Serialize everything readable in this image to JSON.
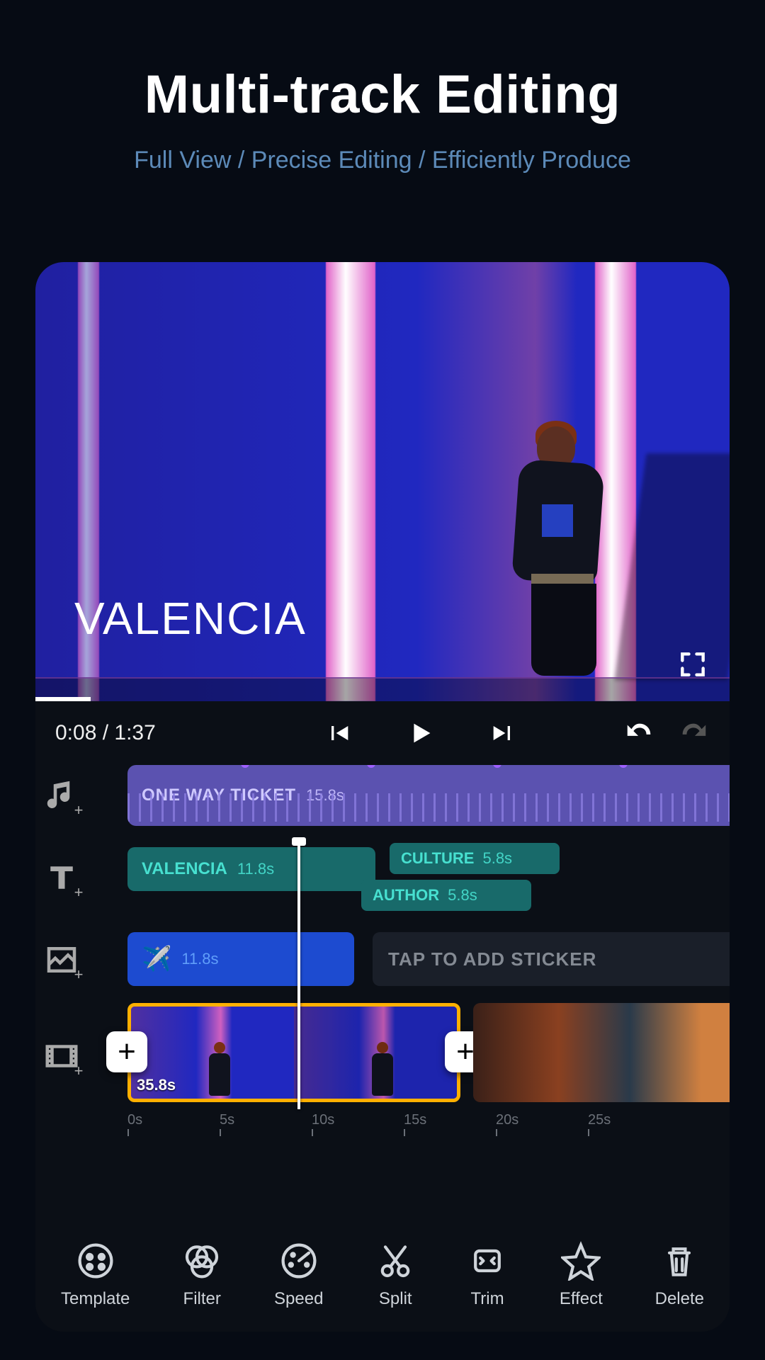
{
  "hero": {
    "title": "Multi-track Editing",
    "subtitle": "Full View / Precise Editing / Efficiently Produce"
  },
  "preview": {
    "overlay_text": "VALENCIA"
  },
  "transport": {
    "current_time": "0:08",
    "separator": " / ",
    "total_time": "1:37"
  },
  "tracks": {
    "music": {
      "title": "ONE WAY TICKET",
      "duration": "15.8s"
    },
    "text": {
      "main": {
        "title": "VALENCIA",
        "duration": "11.8s"
      },
      "chips": [
        {
          "title": "CULTURE",
          "duration": "5.8s"
        },
        {
          "title": "AUTHOR",
          "duration": "5.8s"
        }
      ]
    },
    "sticker": {
      "emoji": "✈️",
      "duration": "11.8s",
      "hint": "TAP TO ADD STICKER"
    },
    "video": {
      "duration": "35.8s"
    }
  },
  "ruler": {
    "labels": [
      "0s",
      "5s",
      "10s",
      "15s",
      "20s",
      "25s"
    ]
  },
  "toolbar": {
    "items": [
      {
        "label": "Template"
      },
      {
        "label": "Filter"
      },
      {
        "label": "Speed"
      },
      {
        "label": "Split"
      },
      {
        "label": "Trim"
      },
      {
        "label": "Effect"
      },
      {
        "label": "Delete"
      }
    ]
  }
}
